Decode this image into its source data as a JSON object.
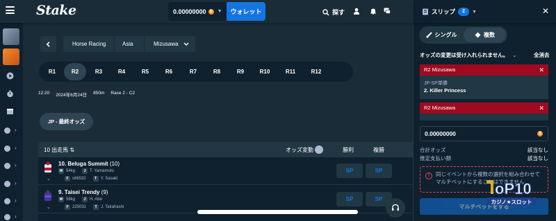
{
  "header": {
    "logo": "Stake",
    "balance": "0.00000000",
    "currency_icon": "bitcoin-coin-icon",
    "wallet_label": "ウォレット",
    "search_label": "探す",
    "icons": [
      "user-icon",
      "bell-icon",
      "chat-icon"
    ]
  },
  "sidebar": {
    "items": [
      "casino-thumbnail",
      "sports-thumbnail",
      "play-icon",
      "stopwatch-icon",
      "calendar-icon",
      "soccer-icon",
      "basketball-icon",
      "tennis-icon",
      "baseball-icon",
      "golf-icon",
      "cricket-icon",
      "hockey-icon"
    ]
  },
  "breadcrumb": {
    "items": [
      "Horse Racing",
      "Asia",
      "Mizusawa"
    ]
  },
  "races": {
    "items": [
      "R1",
      "R2",
      "R3",
      "R4",
      "R5",
      "R6",
      "R7",
      "R8",
      "R9",
      "R10",
      "R11",
      "R12"
    ],
    "active": "R2"
  },
  "race_info": {
    "time": "12:20",
    "date": "2024年6月24日",
    "distance": "850m",
    "class": "Race 2 - C2"
  },
  "odds_button": "JP - 最終オッズ",
  "table": {
    "runners_header": "10 出走馬",
    "odds_change_label": "オッズ変動",
    "win_label": "勝利",
    "place_label": "複勝",
    "runners": [
      {
        "name": "10. Beluga Summit",
        "barrier": "(10)",
        "weight": "54kg",
        "jockey": "T. Yamamoto",
        "form": "x86532",
        "trainer": "Y. Sasaki",
        "win": "SP",
        "place": "SP"
      },
      {
        "name": "9. Taisei Trendy",
        "barrier": "(9)",
        "weight": "56kg",
        "jockey": "H. Abe",
        "form": "225031",
        "trainer": "J. Takahashi",
        "win": "SP",
        "place": "SP"
      }
    ]
  },
  "betslip": {
    "title": "スリップ",
    "count": "2",
    "tab_single": "シングル",
    "tab_multi": "複数",
    "odds_change_notice": "オッズの変更は受け入れられません。",
    "clear_all": "全消去",
    "bets": [
      {
        "race": "R2 Mizusawa",
        "market": "JP-SP単勝",
        "selection": "2. Killer Princess"
      },
      {
        "race": "R2 Mizusawa"
      }
    ],
    "stake_value": "0.00000000",
    "total_odds_label": "合計オッズ",
    "total_odds_value": "該当なし",
    "est_payout_label": "推定支払い額",
    "est_payout_value": "該当なし",
    "warning": "同じイベントから複数の選択を組み合わせてマルチベットにすることはできません",
    "place_button": "マルチベットをする"
  },
  "watermark": {
    "brand": "ToP10",
    "sub": "カジノ★スロット"
  },
  "colors": {
    "bg": "#1a2c38",
    "panel": "#0f212e",
    "accent_blue": "#1475e1",
    "bet_header_red": "#9f0a21"
  }
}
